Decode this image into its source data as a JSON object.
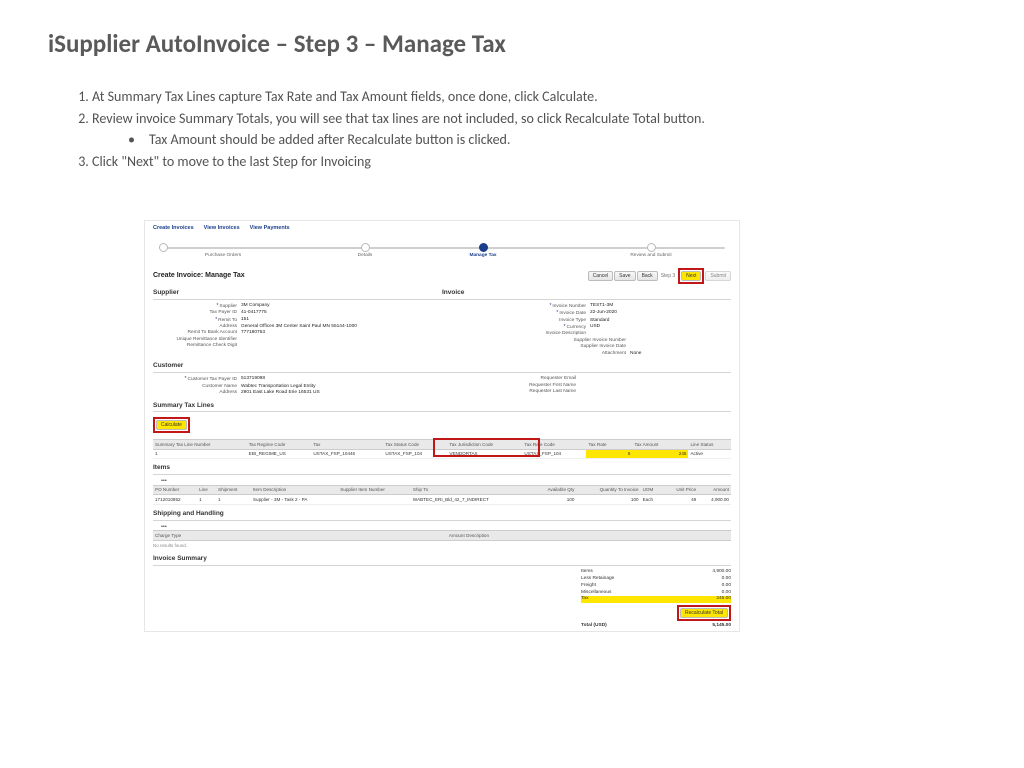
{
  "title": "iSupplier AutoInvoice – Step 3 – Manage Tax",
  "steps": {
    "s1": "At Summary Tax Lines capture Tax Rate and Tax Amount fields, once done, click Calculate.",
    "s2": "Review invoice Summary Totals, you will see that tax lines are not included, so click Recalculate Total button.",
    "s2a": "Tax Amount should be added after Recalculate button is clicked.",
    "s3": "Click \"Next\" to move to the last Step for Invoicing"
  },
  "tabs": {
    "create": "Create Invoices",
    "view": "View Invoices",
    "pay": "View Payments"
  },
  "train": {
    "po": "Purchase Orders",
    "details": "Details",
    "tax": "Manage Tax",
    "review": "Review and Submit"
  },
  "head": {
    "title": "Create Invoice: Manage Tax",
    "cancel": "Cancel",
    "save": "Save",
    "back": "Back",
    "step": "Step 3",
    "next": "Next",
    "submit": "Submit"
  },
  "supplier": {
    "h": "Supplier",
    "k": {
      "supplier": "Supplier",
      "payer": "Tax Payer ID",
      "remit": "Remit To",
      "addr": "Address",
      "bank": "Remit To Bank Account",
      "uri": "Unique Remittance Identifier",
      "chk": "Remittance Check Digit"
    },
    "v": {
      "supplier": "3M Company",
      "payer": "41-0417775",
      "remit": "151",
      "addr": "General Offices 3M Center Saint Paul MN 55144-1000",
      "bank": "777180753",
      "uri": "",
      "chk": ""
    }
  },
  "invoice": {
    "h": "Invoice",
    "k": {
      "num": "Invoice Number",
      "date": "Invoice Date",
      "type": "Invoice Type",
      "cur": "Currency",
      "desc": "Invoice Description",
      "snum": "Supplier Invoice Number",
      "sdate": "Supplier Invoice Date",
      "att": "Attachment"
    },
    "v": {
      "num": "TEST1-3M",
      "date": "22-Jun-2020",
      "type": "Standard",
      "cur": "USD",
      "desc": "",
      "snum": "",
      "sdate": "",
      "att": "None"
    }
  },
  "customer": {
    "h": "Customer",
    "k": {
      "payer": "Customer Tax Payer ID",
      "name": "Customer Name",
      "addr": "Address",
      "email": "Requester Email",
      "first": "Requester First Name",
      "last": "Requester Last Name"
    },
    "v": {
      "payer": "513719098",
      "name": "Wabtec Transportation Legal Entity",
      "addr": "2901 East Lake Road Erie 16531 US",
      "email": "",
      "first": "",
      "last": ""
    }
  },
  "taxlines": {
    "h": "Summary Tax Lines",
    "calc": "Calculate",
    "cols": {
      "ln": "Summary Tax Line Number",
      "regime": "Tax Regime Code",
      "tax": "Tax",
      "status": "Tax Status Code",
      "juris": "Tax Jurisdiction Code",
      "ratecode": "Tax Rate Code",
      "rate": "Tax Rate",
      "amt": "Tax Amount",
      "lstat": "Line Status"
    },
    "row": {
      "ln": "1",
      "regime": "EBI_REGIME_US",
      "tax": "USTAX_FSP_10446",
      "status": "USTAX_FSP_104",
      "juris": "VENDORTAX",
      "ratecode": "USTAX_FSP_104",
      "rate": "5",
      "amt": "245",
      "lstat": "Active"
    }
  },
  "items": {
    "h": "Items",
    "cols": {
      "po": "PO Number",
      "line": "Line",
      "ship": "Shipment",
      "desc": "Item Description",
      "sitem": "Supplier Item Number",
      "shipto": "Ship To",
      "avail": "Available Qty",
      "qty": "Quantity To Invoice",
      "uom": "UOM",
      "price": "Unit Price",
      "amt": "Amount"
    },
    "row": {
      "po": "1712010852",
      "line": "1",
      "ship": "1",
      "desc": "Supplier - 3M - Task 2 - PA",
      "sitem": "",
      "shipto": "WABTEC_ERI_Bld_42_7_INDIRECT",
      "avail": "100",
      "qty": "100",
      "uom": "Each",
      "price": "49",
      "amt": "4,900.00"
    }
  },
  "shipping": {
    "h": "Shipping and Handling",
    "charge": "Charge Type",
    "amtdesc": "Amount Description",
    "none": "No results found."
  },
  "summary": {
    "h": "Invoice Summary",
    "labels": {
      "items": "Items",
      "retain": "Less Retainage",
      "freight": "Freight",
      "misc": "Miscellaneous",
      "tax": "Tax",
      "total": "Total (USD)"
    },
    "vals": {
      "items": "4,900.00",
      "retain": "0.00",
      "freight": "0.00",
      "misc": "0.00",
      "tax": "245.00",
      "total": "5,145.00"
    },
    "recalc": "Recalculate Total"
  }
}
